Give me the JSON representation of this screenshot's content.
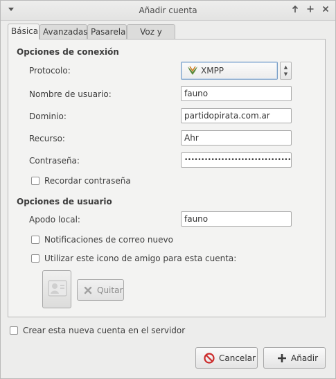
{
  "window": {
    "title": "Añadir cuenta"
  },
  "tabs": [
    {
      "label": "Básica"
    },
    {
      "label": "Avanzadas"
    },
    {
      "label": "Pasarela"
    },
    {
      "label": "Voz y vídeo"
    }
  ],
  "connection": {
    "heading": "Opciones de conexión",
    "protocol_label": "Protocolo:",
    "protocol_value": "XMPP",
    "username_label": "Nombre de usuario:",
    "username_value": "fauno",
    "domain_label": "Dominio:",
    "domain_value": "partidopirata.com.ar",
    "resource_label": "Recurso:",
    "resource_value": "Ahr",
    "password_label": "Contraseña:",
    "password_value": "••••••••••••••••••••••••••••••••",
    "remember_label": "Recordar contraseña",
    "remember_checked": false
  },
  "user": {
    "heading": "Opciones de usuario",
    "alias_label": "Apodo local:",
    "alias_value": "fauno",
    "mail_notify_label": "Notificaciones de correo nuevo",
    "mail_notify_checked": false,
    "buddy_icon_label": "Utilizar este icono de amigo para esta cuenta:",
    "buddy_icon_checked": false,
    "remove_label": "Quitar"
  },
  "create_on_server_label": "Crear esta nueva cuenta en el servidor",
  "create_on_server_checked": false,
  "buttons": {
    "cancel": "Cancelar",
    "add": "Añadir"
  }
}
